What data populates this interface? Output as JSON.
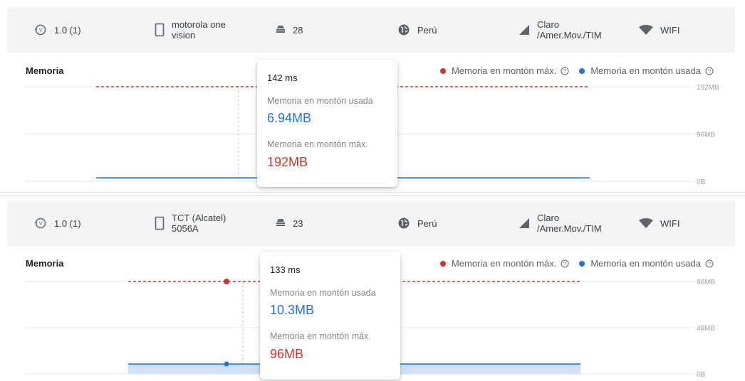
{
  "panels": [
    {
      "app_version": "1.0 (1)",
      "device": "motorola one vision",
      "device_line1": "motorola one",
      "device_line2": "vision",
      "api_level": "28",
      "country": "Perú",
      "carrier_line1": "Claro",
      "carrier_line2": "/Amer.Mov./TIM",
      "network": "WIFI",
      "section_title": "Memoria",
      "legend_max": "Memoria en montón máx.",
      "legend_used": "Memoria en montón usada",
      "axis_labels": [
        "192MB",
        "96MB",
        "0B"
      ],
      "tooltip": {
        "time": "142 ms",
        "used_label": "Memoria en montón usada",
        "used_value": "6.94MB",
        "max_label": "Memoria en montón máx.",
        "max_value": "192MB"
      },
      "chart_data": {
        "type": "line",
        "title": "Memoria",
        "y_ticks": [
          "0B",
          "96MB",
          "192MB"
        ],
        "ylim_mb": [
          0,
          192
        ],
        "series": [
          {
            "name": "Memoria en montón máx.",
            "color": "#d93025",
            "style": "dashed",
            "value_mb": 192
          },
          {
            "name": "Memoria en montón usada",
            "color": "#1a73e8",
            "style": "solid",
            "value_mb": 6.94
          }
        ],
        "hover": {
          "x_label": "142 ms",
          "used_mb": 6.94,
          "max_mb": 192
        }
      }
    },
    {
      "app_version": "1.0 (1)",
      "device": "TCT (Alcatel) 5056A",
      "device_line1": "TCT (Alcatel)",
      "device_line2": "5056A",
      "api_level": "23",
      "country": "Perú",
      "carrier_line1": "Claro",
      "carrier_line2": "/Amer.Mov./TIM",
      "network": "WIFI",
      "section_title": "Memoria",
      "legend_max": "Memoria en montón máx.",
      "legend_used": "Memoria en montón usada",
      "axis_labels": [
        "96MB",
        "48MB",
        "0B"
      ],
      "tooltip": {
        "time": "133 ms",
        "used_label": "Memoria en montón usada",
        "used_value": "10.3MB",
        "max_label": "Memoria en montón máx.",
        "max_value": "96MB"
      },
      "chart_data": {
        "type": "area",
        "title": "Memoria",
        "y_ticks": [
          "0B",
          "48MB",
          "96MB"
        ],
        "ylim_mb": [
          0,
          96
        ],
        "series": [
          {
            "name": "Memoria en montón máx.",
            "color": "#d93025",
            "style": "dashed",
            "value_mb": 96
          },
          {
            "name": "Memoria en montón usada",
            "color": "#1a73e8",
            "style": "solid-area",
            "value_mb": 10.3
          }
        ],
        "hover": {
          "x_label": "133 ms",
          "used_mb": 10.3,
          "max_mb": 96
        }
      }
    }
  ],
  "colors": {
    "max": "#d93025",
    "used": "#1a73e8",
    "header_bg": "#f1f3f4"
  },
  "icons": [
    "version-history-icon",
    "phone-icon",
    "api-level-icon",
    "globe-icon",
    "signal-icon",
    "wifi-icon",
    "help-icon"
  ]
}
